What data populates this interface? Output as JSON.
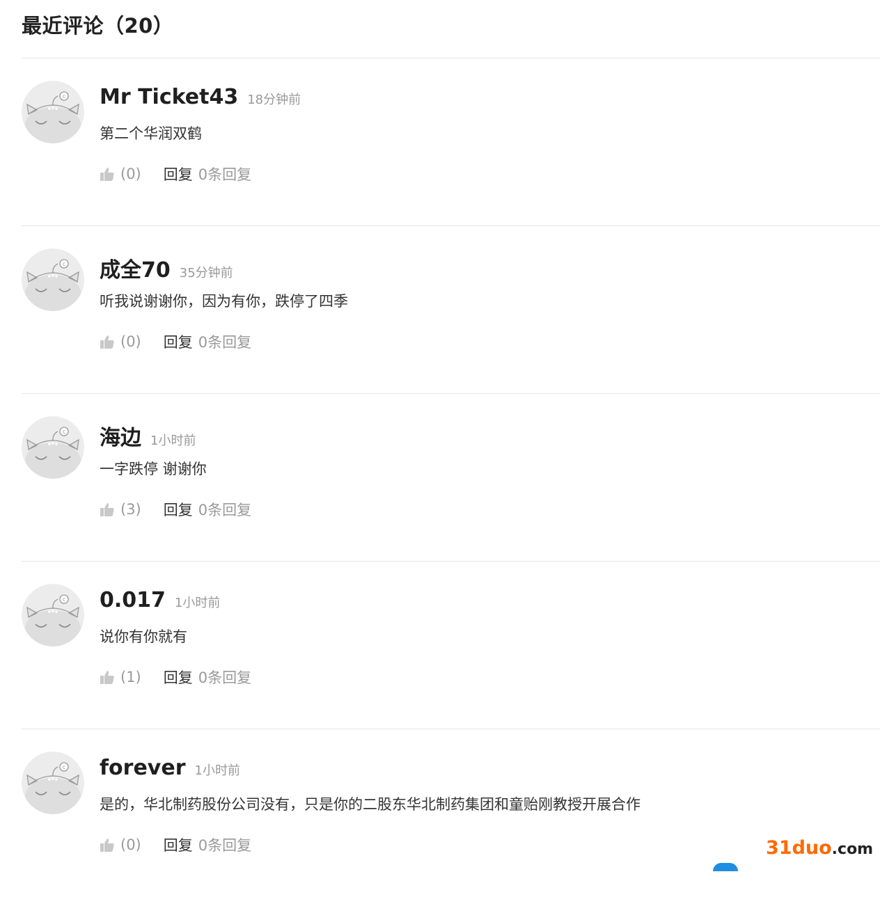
{
  "section": {
    "title": "最近评论（20）"
  },
  "comments": [
    {
      "user": "Mr Ticket43",
      "time": "18分钟前",
      "text": "第二个华润双鹤",
      "likes": "(0)",
      "reply_label": "回复",
      "reply_count": "0条回复"
    },
    {
      "user": "成全70",
      "time": "35分钟前",
      "text": "听我说谢谢你，因为有你，跌停了四季",
      "likes": "(0)",
      "reply_label": "回复",
      "reply_count": "0条回复"
    },
    {
      "user": "海边",
      "time": "1小时前",
      "text": "一字跌停 谢谢你",
      "likes": "(3)",
      "reply_label": "回复",
      "reply_count": "0条回复"
    },
    {
      "user": "0.017",
      "time": "1小时前",
      "text": "说你有你就有",
      "likes": "(1)",
      "reply_label": "回复",
      "reply_count": "0条回复"
    },
    {
      "user": "forever",
      "time": "1小时前",
      "text": "是的，华北制药股份公司没有，只是你的二股东华北制药集团和童贻刚教授开展合作",
      "likes": "(0)",
      "reply_label": "回复",
      "reply_count": "0条回复"
    }
  ],
  "icons": {
    "avatar": "default-avatar-icon",
    "like": "thumbs-up-icon"
  },
  "colors": {
    "watermark_accent": "#ff6a00",
    "muted_text": "#999999",
    "divider": "#e6e6e6"
  },
  "watermark": {
    "part1": "31duo",
    "part2": ".com"
  }
}
